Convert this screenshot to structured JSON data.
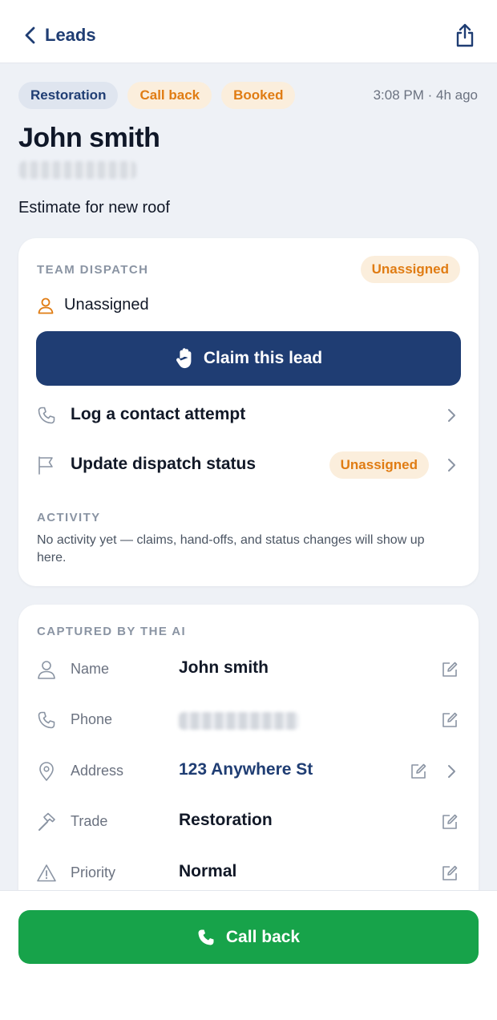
{
  "nav": {
    "back_label": "Leads",
    "back_icon": "chevron-left-icon",
    "share_icon": "share-icon"
  },
  "lead": {
    "tags": [
      {
        "label": "Restoration",
        "color": "#1f3d73"
      },
      {
        "label": "Call back",
        "color": "#e07c13"
      },
      {
        "label": "Booked",
        "color": "#e07c13"
      }
    ],
    "timestamp": "3:08 PM · 4h ago",
    "name": "John smith",
    "summary": "Estimate for new roof"
  },
  "dispatch": {
    "section_label": "TEAM DISPATCH",
    "status_badge": "Unassigned",
    "assignee": "Unassigned",
    "claim_label": "Claim this lead",
    "log_label": "Log a contact attempt",
    "update_label": "Update dispatch status",
    "update_badge": "Unassigned",
    "activity_label": "ACTIVITY",
    "activity_text": "No activity yet — claims, hand-offs, and status changes will show up here."
  },
  "captured": {
    "section_label": "CAPTURED BY THE AI",
    "fields": [
      {
        "label": "Name",
        "value": "John smith",
        "icon": "person-icon"
      },
      {
        "label": "Phone",
        "value": "",
        "icon": "phone-icon"
      },
      {
        "label": "Address",
        "value": "123 Anywhere St",
        "icon": "location-pin-icon"
      },
      {
        "label": "Trade",
        "value": "Restoration",
        "icon": "hammer-icon"
      },
      {
        "label": "Priority",
        "value": "Normal",
        "icon": "warning-icon"
      }
    ]
  },
  "footer": {
    "callback_label": "Call back"
  },
  "colors": {
    "primary": "#1f3d73",
    "accent_orange": "#e07c13",
    "success": "#17a34a",
    "background": "#eef1f6"
  }
}
